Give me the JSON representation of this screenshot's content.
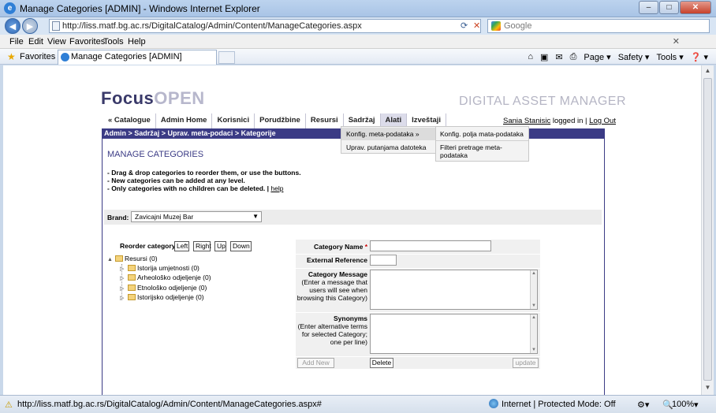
{
  "window": {
    "title": "Manage Categories [ADMIN] - Windows Internet Explorer",
    "controls": {
      "minimize": "–",
      "maximize": "□",
      "close": "✕"
    }
  },
  "addressbar": {
    "url": "http://liss.matf.bg.ac.rs/DigitalCatalog/Admin/Content/ManageCategories.aspx",
    "search_placeholder": "Google"
  },
  "menubar": [
    "File",
    "Edit",
    "View",
    "Favorites",
    "Tools",
    "Help"
  ],
  "favbar": {
    "favorites_label": "Favorites",
    "tab_title": "Manage Categories [ADMIN]",
    "commands": [
      "Page ▾",
      "Safety ▾",
      "Tools ▾",
      "❓ ▾"
    ]
  },
  "site": {
    "logo_focus": "Focus",
    "logo_open": "OPEN",
    "tagline": "DIGITAL ASSET MANAGER",
    "nav": [
      "« Catalogue",
      "Admin Home",
      "Korisnici",
      "Porudžbine",
      "Resursi",
      "Sadržaj",
      "Alati",
      "Izveštaji"
    ],
    "user_name": "Sania Stanisic",
    "logged_in_text": "logged in",
    "logout": "Log Out",
    "breadcrumb": "Admin > Sadržaj > Uprav. meta-podaci > Kategorije",
    "dropdown_alati": [
      "Konfig. meta-podataka »",
      "Uprav. putanjama datoteka"
    ],
    "dropdown_submenu": [
      "Konfig. polja mata-podataka",
      "Filteri pretrage meta-podataka"
    ]
  },
  "page": {
    "heading": "MANAGE CATEGORIES",
    "instructions": [
      "- Drag & drop categories to reorder them, or use the buttons.",
      "- New categories can be added at any level.",
      "- Only categories with no children can be deleted. |"
    ],
    "help_link": "help",
    "brand_label": "Brand:",
    "brand_value": "Zavicajni Muzej Bar",
    "reorder_label": "Reorder category",
    "reorder_buttons": [
      "Left",
      "Right",
      "Up",
      "Down"
    ],
    "tree": {
      "root": "Resursi (0)",
      "children": [
        "Istorija umjetnosti (0)",
        "Arheološko odjeljenje (0)",
        "Etnološko odjeljenje (0)",
        "Istorijsko odjeljenje (0)"
      ]
    },
    "form": {
      "category_name_label": "Category Name",
      "required_mark": "*",
      "external_reference_label": "External Reference",
      "category_message_label": "Category Message",
      "category_message_note": "(Enter a message that users will see when browsing this Category)",
      "synonyms_label": "Synonyms",
      "synonyms_note": "(Enter alternative terms for selected Category; one per line)",
      "add_new": "Add New",
      "delete": "Delete",
      "update": "update"
    }
  },
  "statusbar": {
    "url": "http://liss.matf.bg.ac.rs/DigitalCatalog/Admin/Content/ManageCategories.aspx#",
    "zone": "Internet | Protected Mode: Off",
    "zoom": "100%"
  },
  "colors": {
    "accent": "#3b3b85",
    "logo_dark": "#3a3a6a",
    "logo_light": "#b7b7cc"
  }
}
